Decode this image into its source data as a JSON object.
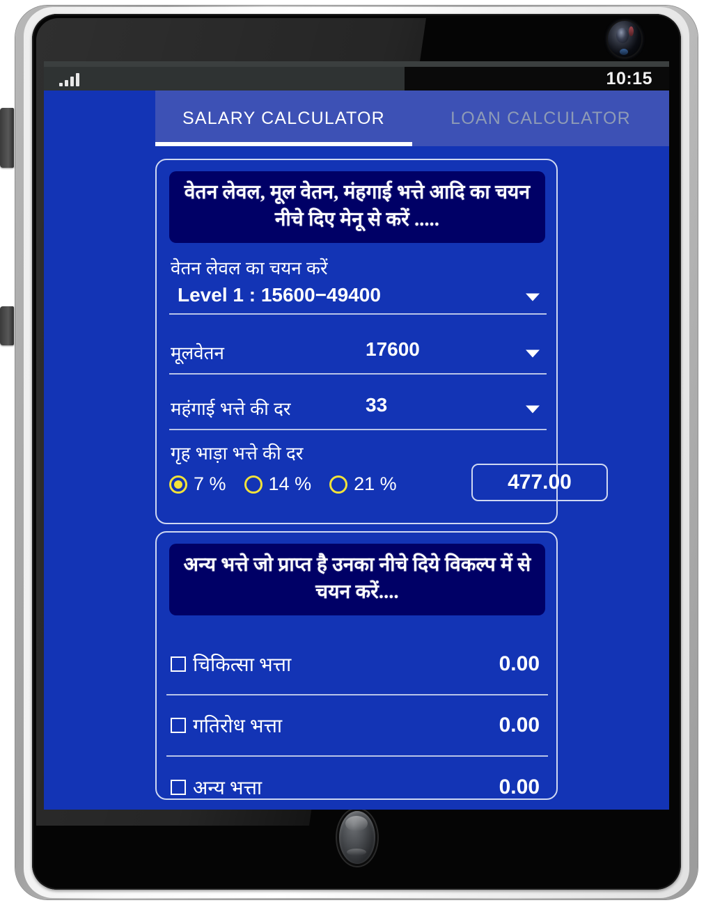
{
  "device": {
    "status_bar": {
      "signal_icon": "signal-bars-icon",
      "time": "10:15"
    },
    "camera_icon": "front-camera-icon",
    "home_button": "home-button",
    "side_buttons": [
      "volume-button",
      "power-button"
    ]
  },
  "app": {
    "tabs": [
      {
        "label": "SALARY CALCULATOR",
        "active": true
      },
      {
        "label": "LOAN CALCULATOR",
        "active": false
      }
    ],
    "salary_card": {
      "banner": "वेतन लेवल, मूल वेतन, मंहगाई भत्ते आदि का चयन नीचे दिए मेनू से करें .....",
      "pay_level": {
        "label": "वेतन लेवल का चयन करें",
        "value": "Level 1 : 15600−49400",
        "caret_icon": "chevron-down-icon"
      },
      "basic_pay": {
        "label": "मूलवेतन",
        "value": "17600",
        "caret_icon": "chevron-down-icon"
      },
      "da_rate": {
        "label": "महंगाई भत्ते की दर",
        "value": "33",
        "caret_icon": "chevron-down-icon"
      },
      "hra": {
        "label": "गृह भाड़ा भत्ते की दर",
        "options": [
          {
            "label": "7 %",
            "selected": true
          },
          {
            "label": "14 %",
            "selected": false
          },
          {
            "label": "21 %",
            "selected": false
          }
        ],
        "amount": "477.00"
      }
    },
    "allowance_card": {
      "banner": "अन्य भत्ते जो प्राप्त है उनका नीचे दिये विकल्प में से चयन करें....",
      "rows": [
        {
          "label": "चिकित्सा भत्ता",
          "value": "0.00",
          "checked": false
        },
        {
          "label": "गतिरोध भत्ता",
          "value": "0.00",
          "checked": false
        },
        {
          "label": "अन्य भत्ता",
          "value": "0.00",
          "checked": false
        }
      ]
    }
  },
  "colors": {
    "app_background": "#1334b5",
    "tab_bar": "#3d51b5",
    "banner_background": "#000066",
    "accent_yellow": "#f2e23a",
    "border_light": "#cfd8f2"
  }
}
